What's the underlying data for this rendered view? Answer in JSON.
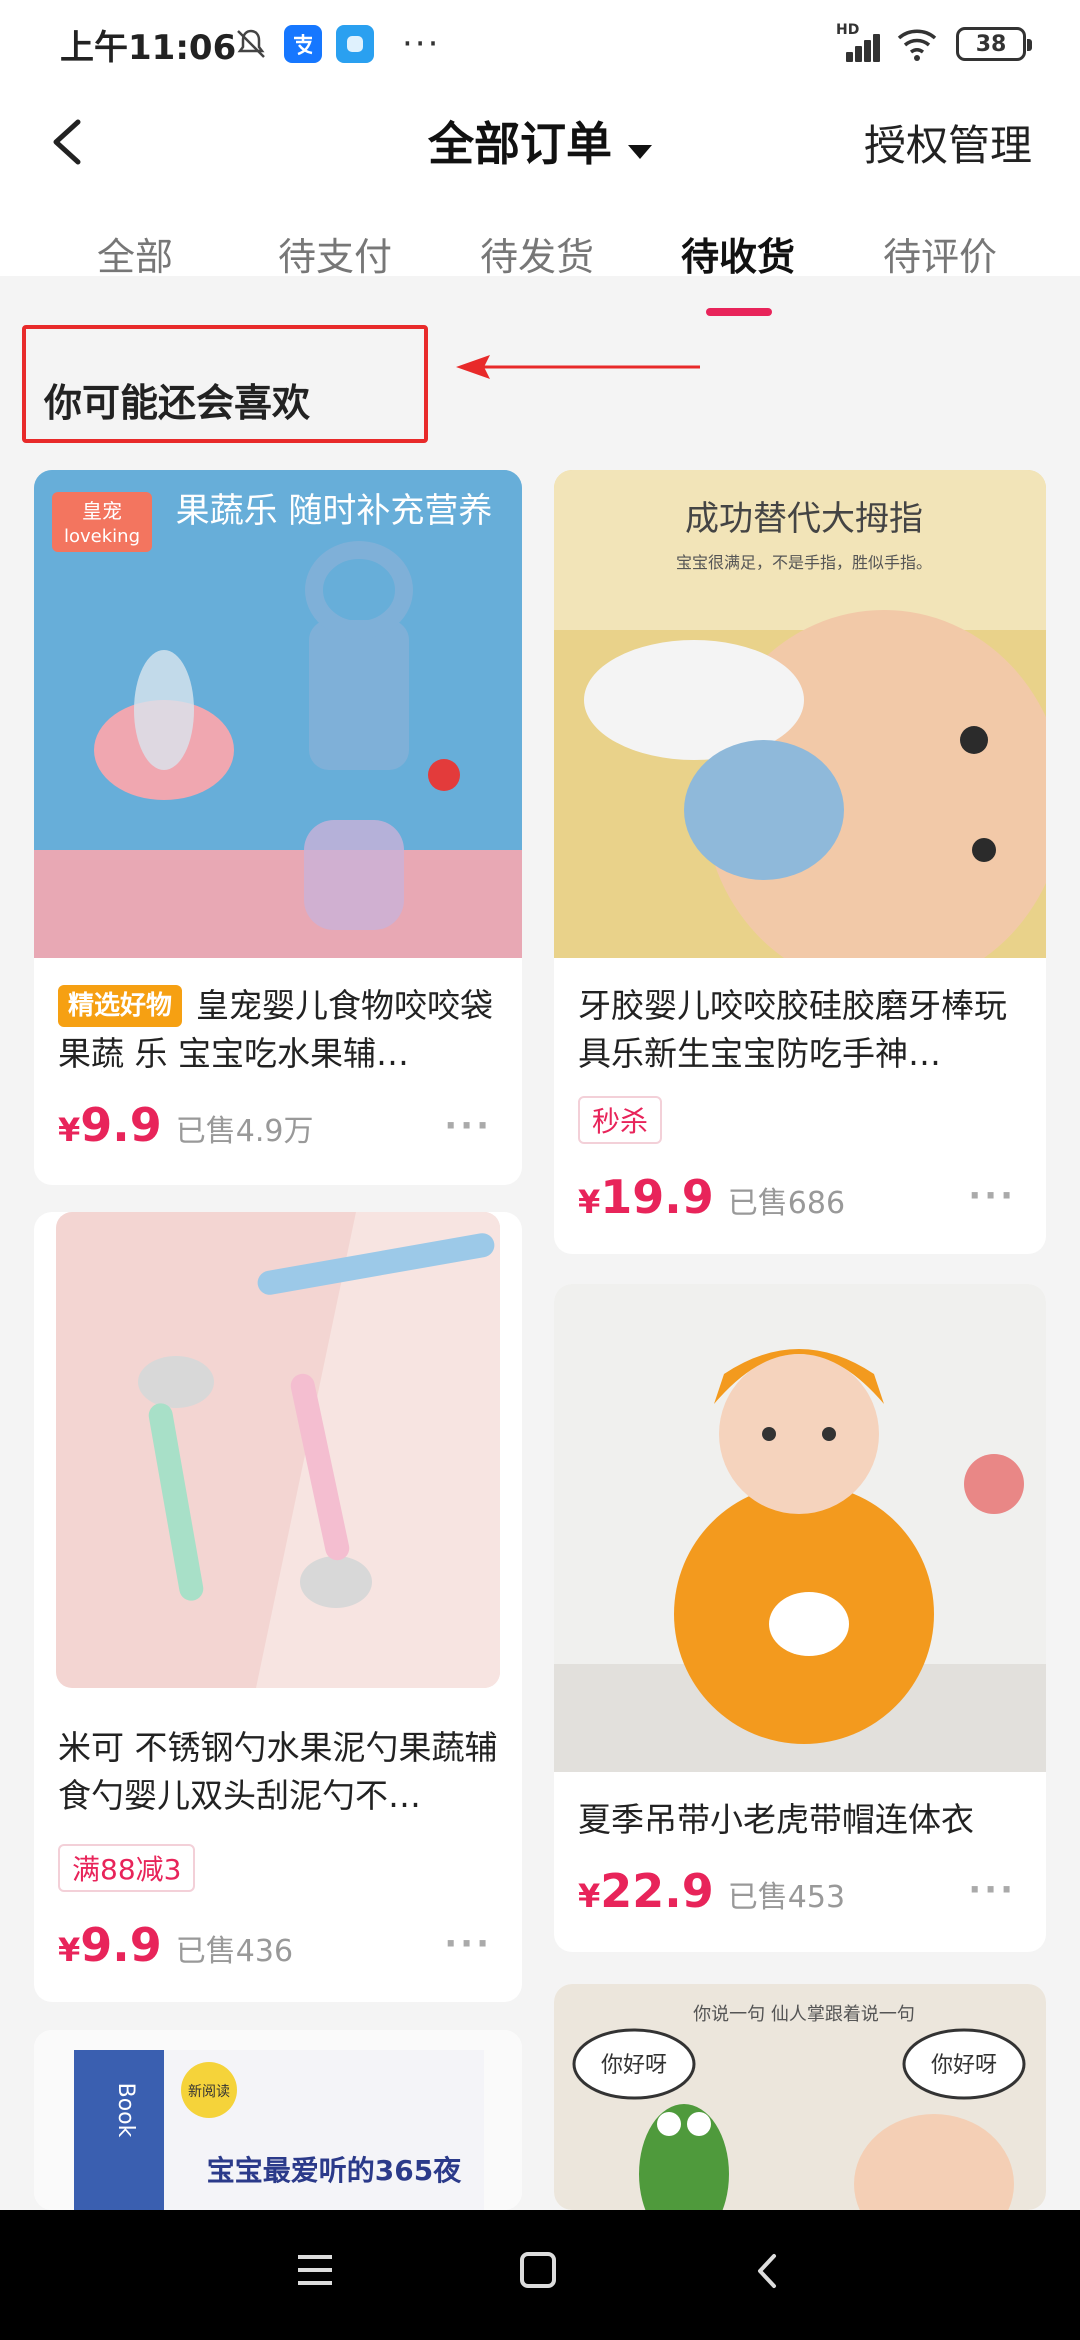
{
  "status_bar": {
    "time": "上午11:06",
    "network": "HD",
    "battery": "38",
    "more": "···",
    "icons": [
      "bell-muted-icon",
      "alipay-icon",
      "app-icon",
      "signal-icon",
      "wifi-icon",
      "battery-icon"
    ]
  },
  "header": {
    "title": "全部订单",
    "auth_manage": "授权管理"
  },
  "tabs": [
    {
      "label": "全部",
      "active": false
    },
    {
      "label": "待支付",
      "active": false
    },
    {
      "label": "待发货",
      "active": false
    },
    {
      "label": "待收货",
      "active": true
    },
    {
      "label": "待评价",
      "active": false
    }
  ],
  "section": {
    "title": "你可能还会喜欢"
  },
  "products": [
    {
      "name": "皇宠婴儿食物咬咬袋果蔬 乐 宝宝吃水果辅…",
      "tag": "精选好物",
      "price_symbol": "¥",
      "price": "9.9",
      "sold": "已售4.9万",
      "image": {
        "brand": "皇宠",
        "logo": "loveking",
        "caption": "果蔬乐 随时补充营养"
      }
    },
    {
      "name": "牙胶婴儿咬咬胶硅胶磨牙棒玩具乐新生宝宝防吃手神…",
      "tag": "秒杀",
      "price_symbol": "¥",
      "price": "19.9",
      "sold": "已售686",
      "image": {
        "headline": "成功替代大拇指",
        "sub": "宝宝很满足，不是手指，胜似手指。"
      }
    },
    {
      "name": "米可 不锈钢勺水果泥勺果蔬辅食勺婴儿双头刮泥勺不…",
      "tag": "满88减3",
      "price_symbol": "¥",
      "price": "9.9",
      "sold": "已售436"
    },
    {
      "name": "夏季吊带小老虎带帽连体衣",
      "price_symbol": "¥",
      "price": "22.9",
      "sold": "已售453"
    },
    {
      "name": "",
      "image": {
        "headline": "宝宝最爱听的365夜",
        "spine": "Book",
        "badge": "新阅读"
      }
    },
    {
      "name": "",
      "image": {
        "sub": "你说一句 仙人掌跟着说一句",
        "bubble1": "你好呀",
        "bubble2": "你好呀"
      }
    }
  ],
  "more_label": "···",
  "nav_bar": {
    "icons": [
      "menu-icon",
      "home-icon",
      "back-icon"
    ]
  },
  "colors": {
    "accent": "#e8245a",
    "tag_orange": "#f6a012",
    "highlight_red": "#e82a2a",
    "page_bg": "#f4f4f4"
  }
}
